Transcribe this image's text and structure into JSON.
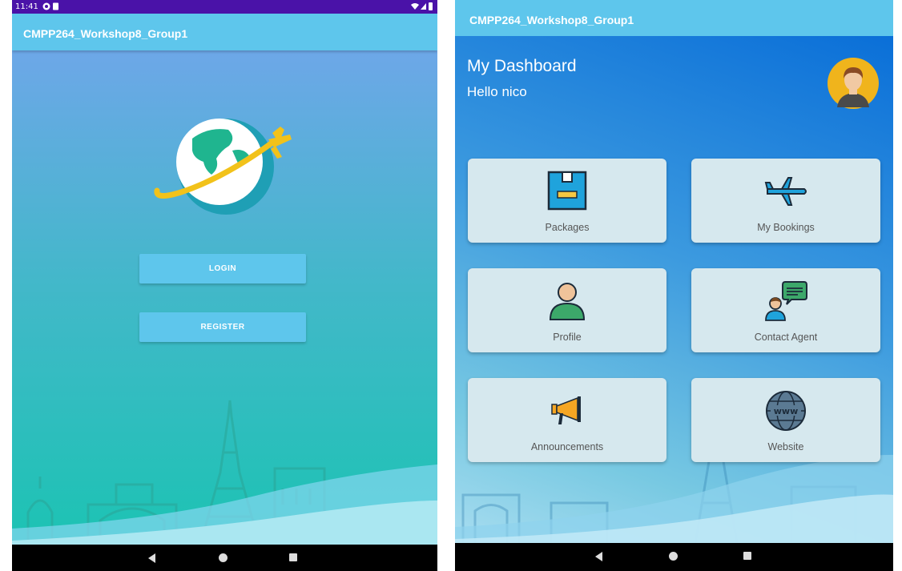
{
  "status_bar": {
    "time": "11:41"
  },
  "login_screen": {
    "app_title": "CMPP264_Workshop8_Group1",
    "login_label": "LOGIN",
    "register_label": "REGISTER"
  },
  "dashboard": {
    "app_title": "CMPP264_Workshop8_Group1",
    "title": "My Dashboard",
    "greeting": "Hello nico",
    "cards": [
      {
        "label": "Packages",
        "icon": "package-icon"
      },
      {
        "label": "My Bookings",
        "icon": "airplane-icon"
      },
      {
        "label": "Profile",
        "icon": "person-icon"
      },
      {
        "label": "Contact Agent",
        "icon": "agent-chat-icon"
      },
      {
        "label": "Announcements",
        "icon": "megaphone-icon"
      },
      {
        "label": "Website",
        "icon": "globe-www-icon"
      }
    ]
  },
  "colors": {
    "status_bar": "#4a12a8",
    "app_bar": "#5ec6ec",
    "button": "#5ec6ec",
    "card": "#d6e8ee",
    "nav_bar": "#000000"
  }
}
